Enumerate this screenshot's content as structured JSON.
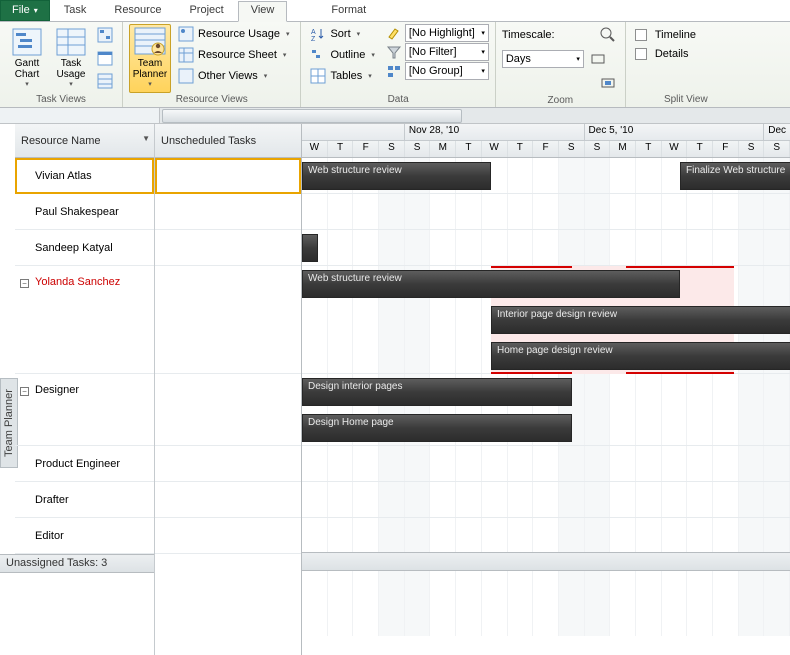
{
  "tabs": {
    "file": "File",
    "task": "Task",
    "resource": "Resource",
    "project": "Project",
    "view": "View",
    "format": "Format"
  },
  "ribbon": {
    "taskviews": {
      "label": "Task Views",
      "gantt": "Gantt\nChart",
      "usage": "Task\nUsage"
    },
    "resviews": {
      "label": "Resource Views",
      "team": "Team\nPlanner",
      "ru": "Resource Usage",
      "rs": "Resource Sheet",
      "ov": "Other Views"
    },
    "data": {
      "label": "Data",
      "sort": "Sort",
      "outline": "Outline",
      "tables": "Tables",
      "hl_lbl": "[No Highlight]",
      "filter_lbl": "[No Filter]",
      "group_lbl": "[No Group]"
    },
    "zoom": {
      "label": "Zoom",
      "timescale": "Timescale:",
      "days": "Days"
    },
    "split": {
      "label": "Split View",
      "timeline": "Timeline",
      "details": "Details"
    }
  },
  "planner": {
    "side": "Team Planner",
    "colA": "Resource Name",
    "colB": "Unscheduled Tasks",
    "resources": [
      "Vivian Atlas",
      "Paul Shakespear",
      "Sandeep Katyal",
      "Yolanda Sanchez",
      "Designer",
      "Product Engineer",
      "Drafter",
      "Editor"
    ],
    "footer": "Unassigned Tasks: 3",
    "weeks": [
      "",
      "Nov 28, '10",
      "Dec 5, '10",
      "Dec"
    ],
    "days": [
      "W",
      "T",
      "F",
      "S",
      "S",
      "M",
      "T",
      "W",
      "T",
      "F",
      "S",
      "S",
      "M",
      "T",
      "W",
      "T",
      "F",
      "S",
      "S"
    ],
    "bars": {
      "wsr1": "Web structure review",
      "fws": "Finalize Web structure",
      "wsr2": "Web structure review",
      "ipdr": "Interior page design review",
      "hpdr": "Home page design review",
      "dip": "Design interior pages",
      "dhp": "Design Home page"
    }
  }
}
